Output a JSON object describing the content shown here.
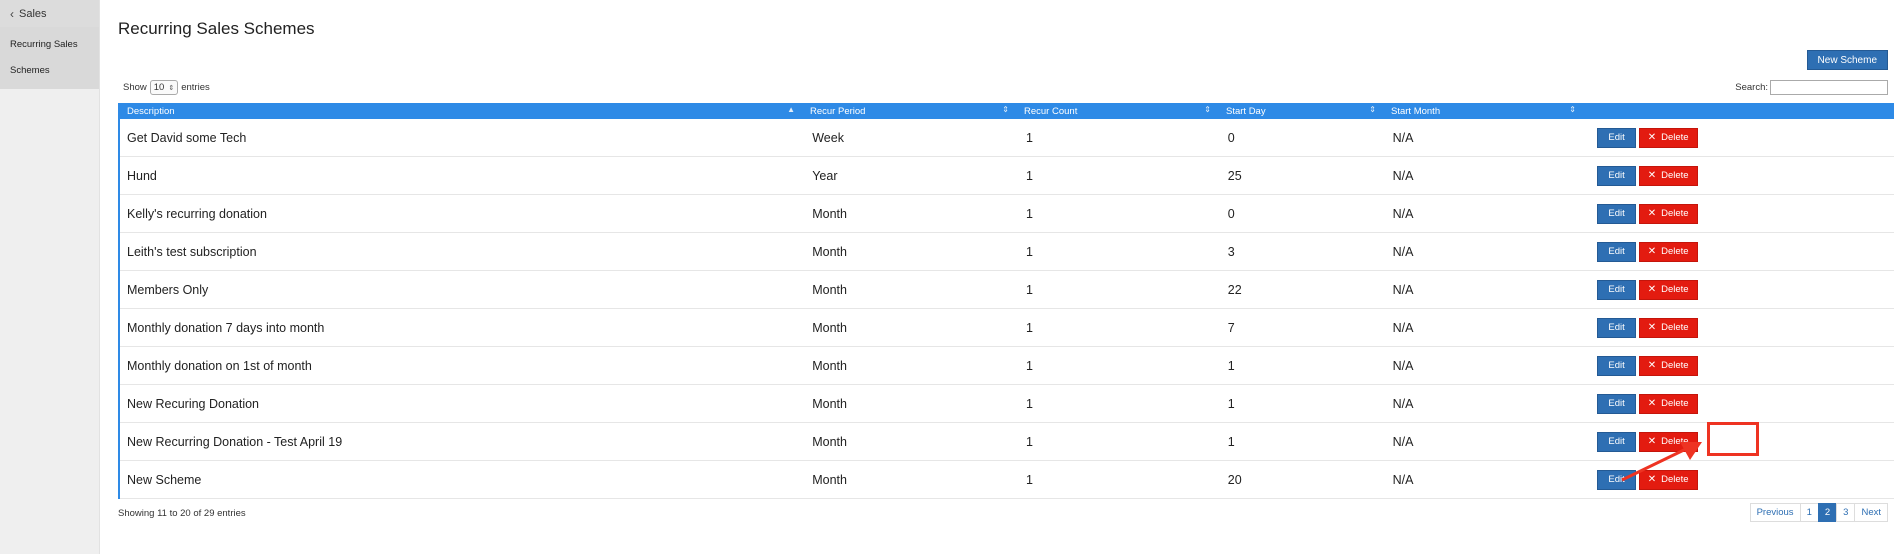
{
  "sidebar": {
    "back_label": "Sales",
    "items": [
      {
        "label": "Recurring Sales"
      },
      {
        "label": "Schemes"
      }
    ]
  },
  "page": {
    "title": "Recurring Sales Schemes",
    "new_button": "New Scheme"
  },
  "table_controls": {
    "show_label": "Show",
    "page_size": "10",
    "entries_label": "entries",
    "search_label": "Search:",
    "search_value": ""
  },
  "table": {
    "columns": [
      "Description",
      "Recur Period",
      "Recur Count",
      "Start Day",
      "Start Month",
      ""
    ],
    "edit_label": "Edit",
    "delete_label": "Delete",
    "rows": [
      {
        "description": "Get David some Tech",
        "period": "Week",
        "count": "1",
        "start_day": "0",
        "start_month": "N/A"
      },
      {
        "description": "Hund",
        "period": "Year",
        "count": "1",
        "start_day": "25",
        "start_month": "N/A"
      },
      {
        "description": "Kelly's recurring donation",
        "period": "Month",
        "count": "1",
        "start_day": "0",
        "start_month": "N/A"
      },
      {
        "description": "Leith's test subscription",
        "period": "Month",
        "count": "1",
        "start_day": "3",
        "start_month": "N/A"
      },
      {
        "description": "Members Only",
        "period": "Month",
        "count": "1",
        "start_day": "22",
        "start_month": "N/A"
      },
      {
        "description": "Monthly donation 7 days into month",
        "period": "Month",
        "count": "1",
        "start_day": "7",
        "start_month": "N/A"
      },
      {
        "description": "Monthly donation on 1st of month",
        "period": "Month",
        "count": "1",
        "start_day": "1",
        "start_month": "N/A"
      },
      {
        "description": "New Recuring Donation",
        "period": "Month",
        "count": "1",
        "start_day": "1",
        "start_month": "N/A"
      },
      {
        "description": "New Recurring Donation - Test April 19",
        "period": "Month",
        "count": "1",
        "start_day": "1",
        "start_month": "N/A"
      },
      {
        "description": "New Scheme",
        "period": "Month",
        "count": "1",
        "start_day": "20",
        "start_month": "N/A"
      }
    ]
  },
  "footer": {
    "info": "Showing 11 to 20 of 29 entries",
    "pagination": {
      "previous": "Previous",
      "pages": [
        "1",
        "2",
        "3"
      ],
      "current": "2",
      "next": "Next"
    }
  },
  "colors": {
    "primary": "#2e6fb3",
    "header": "#2e8ae6",
    "danger": "#e31b10",
    "annotation": "#ee3322"
  }
}
